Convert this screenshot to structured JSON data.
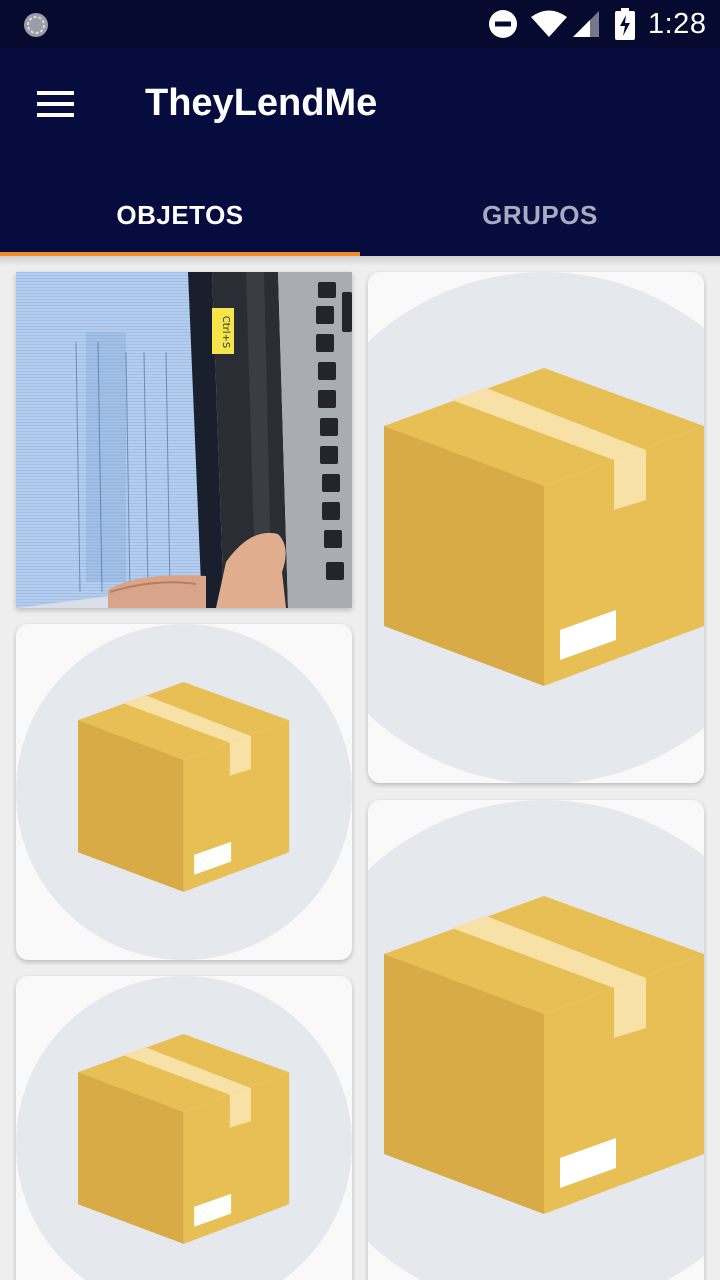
{
  "status_bar": {
    "time": "1:28",
    "icons": [
      "sync-icon",
      "do-not-disturb-icon",
      "wifi-icon",
      "signal-icon",
      "battery-charging-icon"
    ]
  },
  "app_bar": {
    "menu_icon": "hamburger-menu-icon",
    "title": "TheyLendMe"
  },
  "tabs": [
    {
      "label": "OBJETOS",
      "active": true
    },
    {
      "label": "GRUPOS",
      "active": false
    }
  ],
  "colors": {
    "status_bar": "#050a2e",
    "app_bar": "#070c3f",
    "tab_indicator": "#f28c28",
    "tab_inactive_text": "#a9acc0",
    "placeholder_circle": "#e5e8ed",
    "box_front": "#d9ab47",
    "box_side": "#e8bf55",
    "box_tape": "#f8e1a6"
  },
  "items": [
    {
      "kind": "photo",
      "icon": "photo-thumbnail",
      "label_text": "Ctrl+S"
    },
    {
      "kind": "placeholder",
      "icon": "package-box-icon"
    },
    {
      "kind": "placeholder",
      "icon": "package-box-icon"
    },
    {
      "kind": "placeholder",
      "icon": "package-box-icon"
    },
    {
      "kind": "placeholder",
      "icon": "package-box-icon"
    }
  ]
}
